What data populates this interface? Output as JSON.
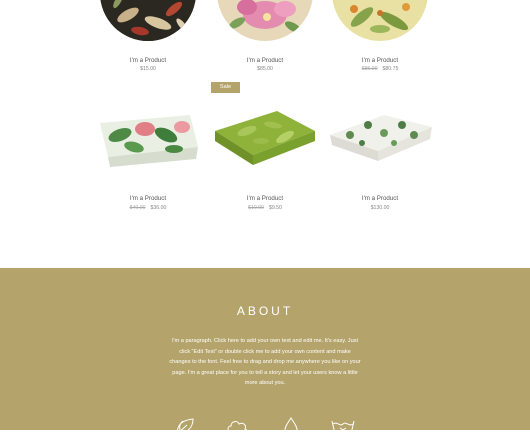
{
  "products_row1": [
    {
      "name": "I'm a Product",
      "price": "$15.00"
    },
    {
      "name": "I'm a Product",
      "price": "$85.00"
    },
    {
      "name": "I'm a Product",
      "old_price": "$85.00",
      "price": "$80.75"
    }
  ],
  "sale_badge": "Sale",
  "products_row2": [
    {
      "name": "I'm a Product",
      "old_price": "$40.00",
      "price": "$36.00"
    },
    {
      "name": "I'm a Product",
      "old_price": "$10.00",
      "price": "$9.50"
    },
    {
      "name": "I'm a Product",
      "price": "$130.00"
    }
  ],
  "about": {
    "title": "ABOUT",
    "paragraph": "I'm a paragraph. Click here to add your own text and edit me. It's easy. Just click “Edit Text” or double click me to add your own content and make changes to the font. Feel free to drag and drop me anywhere you like on your page. I'm a great place for you to tell a story and let your users know a little more about you."
  },
  "colors": {
    "accent": "#b4a46b",
    "white": "#ffffff"
  },
  "icons": [
    "leaf-icon",
    "cloud-icon",
    "drop-icon",
    "wash-icon"
  ]
}
